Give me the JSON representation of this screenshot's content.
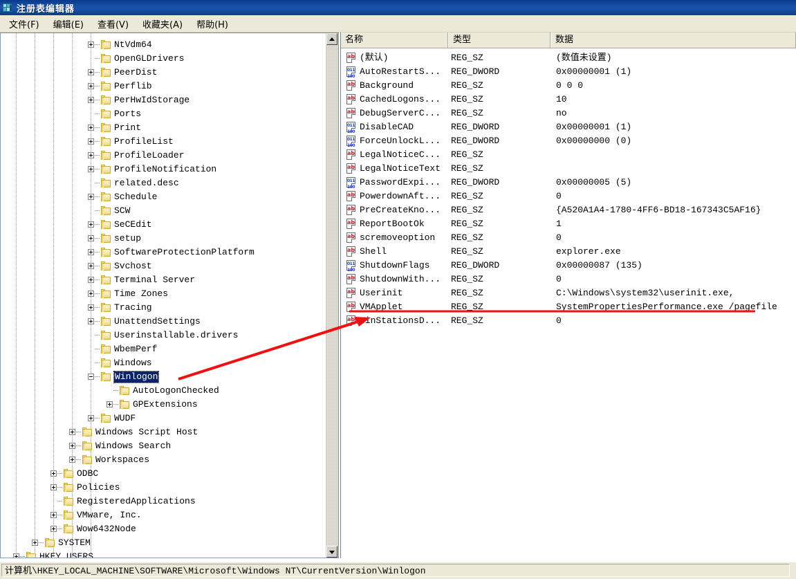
{
  "window": {
    "title": "注册表编辑器",
    "icon": "registry-editor-icon"
  },
  "menu": {
    "items": [
      {
        "label": "文件(F)"
      },
      {
        "label": "编辑(E)"
      },
      {
        "label": "查看(V)"
      },
      {
        "label": "收藏夹(A)"
      },
      {
        "label": "帮助(H)"
      }
    ]
  },
  "tree": {
    "nodes": [
      {
        "label": "NtVdm64",
        "depth": 4,
        "expander": "plus",
        "selected": false
      },
      {
        "label": "OpenGLDrivers",
        "depth": 4,
        "expander": "none",
        "selected": false
      },
      {
        "label": "PeerDist",
        "depth": 4,
        "expander": "plus",
        "selected": false
      },
      {
        "label": "Perflib",
        "depth": 4,
        "expander": "plus",
        "selected": false
      },
      {
        "label": "PerHwIdStorage",
        "depth": 4,
        "expander": "plus",
        "selected": false
      },
      {
        "label": "Ports",
        "depth": 4,
        "expander": "none",
        "selected": false
      },
      {
        "label": "Print",
        "depth": 4,
        "expander": "plus",
        "selected": false
      },
      {
        "label": "ProfileList",
        "depth": 4,
        "expander": "plus",
        "selected": false
      },
      {
        "label": "ProfileLoader",
        "depth": 4,
        "expander": "plus",
        "selected": false
      },
      {
        "label": "ProfileNotification",
        "depth": 4,
        "expander": "plus",
        "selected": false
      },
      {
        "label": "related.desc",
        "depth": 4,
        "expander": "none",
        "selected": false
      },
      {
        "label": "Schedule",
        "depth": 4,
        "expander": "plus",
        "selected": false
      },
      {
        "label": "SCW",
        "depth": 4,
        "expander": "none",
        "selected": false
      },
      {
        "label": "SeCEdit",
        "depth": 4,
        "expander": "plus",
        "selected": false
      },
      {
        "label": "setup",
        "depth": 4,
        "expander": "plus",
        "selected": false
      },
      {
        "label": "SoftwareProtectionPlatform",
        "depth": 4,
        "expander": "plus",
        "selected": false
      },
      {
        "label": "Svchost",
        "depth": 4,
        "expander": "plus",
        "selected": false
      },
      {
        "label": "Terminal Server",
        "depth": 4,
        "expander": "plus",
        "selected": false
      },
      {
        "label": "Time Zones",
        "depth": 4,
        "expander": "plus",
        "selected": false
      },
      {
        "label": "Tracing",
        "depth": 4,
        "expander": "plus",
        "selected": false
      },
      {
        "label": "UnattendSettings",
        "depth": 4,
        "expander": "plus",
        "selected": false
      },
      {
        "label": "Userinstallable.drivers",
        "depth": 4,
        "expander": "none",
        "selected": false
      },
      {
        "label": "WbemPerf",
        "depth": 4,
        "expander": "none",
        "selected": false
      },
      {
        "label": "Windows",
        "depth": 4,
        "expander": "none",
        "selected": false
      },
      {
        "label": "Winlogon",
        "depth": 4,
        "expander": "minus",
        "selected": true
      },
      {
        "label": "AutoLogonChecked",
        "depth": 5,
        "expander": "none",
        "selected": false
      },
      {
        "label": "GPExtensions",
        "depth": 5,
        "expander": "plus",
        "selected": false
      },
      {
        "label": "WUDF",
        "depth": 4,
        "expander": "plus",
        "selected": false
      },
      {
        "label": "Windows Script Host",
        "depth": 3,
        "expander": "plus",
        "selected": false
      },
      {
        "label": "Windows Search",
        "depth": 3,
        "expander": "plus",
        "selected": false
      },
      {
        "label": "Workspaces",
        "depth": 3,
        "expander": "plus",
        "selected": false
      },
      {
        "label": "ODBC",
        "depth": 2,
        "expander": "plus",
        "selected": false
      },
      {
        "label": "Policies",
        "depth": 2,
        "expander": "plus",
        "selected": false
      },
      {
        "label": "RegisteredApplications",
        "depth": 2,
        "expander": "none",
        "selected": false
      },
      {
        "label": "VMware, Inc.",
        "depth": 2,
        "expander": "plus",
        "selected": false
      },
      {
        "label": "Wow6432Node",
        "depth": 2,
        "expander": "plus",
        "selected": false
      },
      {
        "label": "SYSTEM",
        "depth": 1,
        "expander": "plus",
        "selected": false
      },
      {
        "label": "HKEY_USERS",
        "depth": 0,
        "expander": "plus",
        "selected": false
      }
    ]
  },
  "list": {
    "columns": [
      {
        "label": "名称"
      },
      {
        "label": "类型"
      },
      {
        "label": "数据"
      }
    ],
    "rows": [
      {
        "name": "(默认)",
        "type": "REG_SZ",
        "data": "(数值未设置)",
        "icon": "string-value-icon"
      },
      {
        "name": "AutoRestartS...",
        "type": "REG_DWORD",
        "data": "0x00000001 (1)",
        "icon": "dword-value-icon"
      },
      {
        "name": "Background",
        "type": "REG_SZ",
        "data": "0 0 0",
        "icon": "string-value-icon"
      },
      {
        "name": "CachedLogons...",
        "type": "REG_SZ",
        "data": "10",
        "icon": "string-value-icon"
      },
      {
        "name": "DebugServerC...",
        "type": "REG_SZ",
        "data": "no",
        "icon": "string-value-icon"
      },
      {
        "name": "DisableCAD",
        "type": "REG_DWORD",
        "data": "0x00000001 (1)",
        "icon": "dword-value-icon"
      },
      {
        "name": "ForceUnlockL...",
        "type": "REG_DWORD",
        "data": "0x00000000 (0)",
        "icon": "dword-value-icon"
      },
      {
        "name": "LegalNoticeC...",
        "type": "REG_SZ",
        "data": "",
        "icon": "string-value-icon"
      },
      {
        "name": "LegalNoticeText",
        "type": "REG_SZ",
        "data": "",
        "icon": "string-value-icon"
      },
      {
        "name": "PasswordExpi...",
        "type": "REG_DWORD",
        "data": "0x00000005 (5)",
        "icon": "dword-value-icon"
      },
      {
        "name": "PowerdownAft...",
        "type": "REG_SZ",
        "data": "0",
        "icon": "string-value-icon"
      },
      {
        "name": "PreCreateKno...",
        "type": "REG_SZ",
        "data": "{A520A1A4-1780-4FF6-BD18-167343C5AF16}",
        "icon": "string-value-icon"
      },
      {
        "name": "ReportBootOk",
        "type": "REG_SZ",
        "data": "1",
        "icon": "string-value-icon"
      },
      {
        "name": "scremoveoption",
        "type": "REG_SZ",
        "data": "0",
        "icon": "string-value-icon"
      },
      {
        "name": "Shell",
        "type": "REG_SZ",
        "data": "explorer.exe",
        "icon": "string-value-icon"
      },
      {
        "name": "ShutdownFlags",
        "type": "REG_DWORD",
        "data": "0x00000087 (135)",
        "icon": "dword-value-icon"
      },
      {
        "name": "ShutdownWith...",
        "type": "REG_SZ",
        "data": "0",
        "icon": "string-value-icon"
      },
      {
        "name": "Userinit",
        "type": "REG_SZ",
        "data": "C:\\Windows\\system32\\userinit.exe,",
        "icon": "string-value-icon"
      },
      {
        "name": "VMApplet",
        "type": "REG_SZ",
        "data": "SystemPropertiesPerformance.exe /pagefile",
        "icon": "string-value-icon"
      },
      {
        "name": "WinStationsD...",
        "type": "REG_SZ",
        "data": "0",
        "icon": "string-value-icon"
      }
    ]
  },
  "statusbar": {
    "path": "计算机\\HKEY_LOCAL_MACHINE\\SOFTWARE\\Microsoft\\Windows NT\\CurrentVersion\\Winlogon"
  },
  "annotations": {
    "accent_color": "#ee1111",
    "arrow": "red-arrow-winlogon-to-vmapplet",
    "underline": "red-underline-userinit-data"
  }
}
